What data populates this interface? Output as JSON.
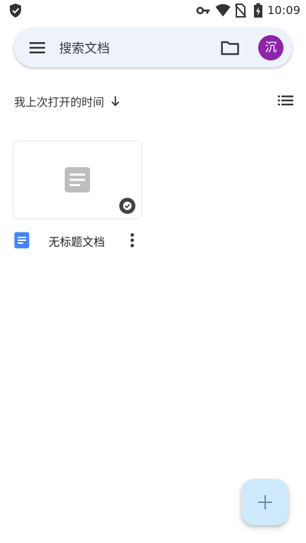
{
  "status_bar": {
    "time": "10:09",
    "icons": [
      "shield-check-icon",
      "vpn-key-icon",
      "wifi-icon",
      "no-sim-icon",
      "battery-charging-icon"
    ]
  },
  "search": {
    "placeholder": "搜索文档",
    "value": "",
    "avatar_initial": "沉",
    "avatar_color": "#8e24aa",
    "search_bar_color": "#eef3fb"
  },
  "sort": {
    "label": "我上次打开的时间",
    "direction_icon": "arrow-down-icon",
    "view_toggle_icon": "list-view-icon"
  },
  "documents": [
    {
      "title": "无标题文档",
      "thumbnail_icon": "document-icon",
      "badge_icon": "offline-available-icon",
      "app_icon": "google-docs-icon",
      "app_icon_color": "#4285f4"
    }
  ],
  "fab": {
    "icon": "plus-icon",
    "color": "#cde9fb"
  }
}
